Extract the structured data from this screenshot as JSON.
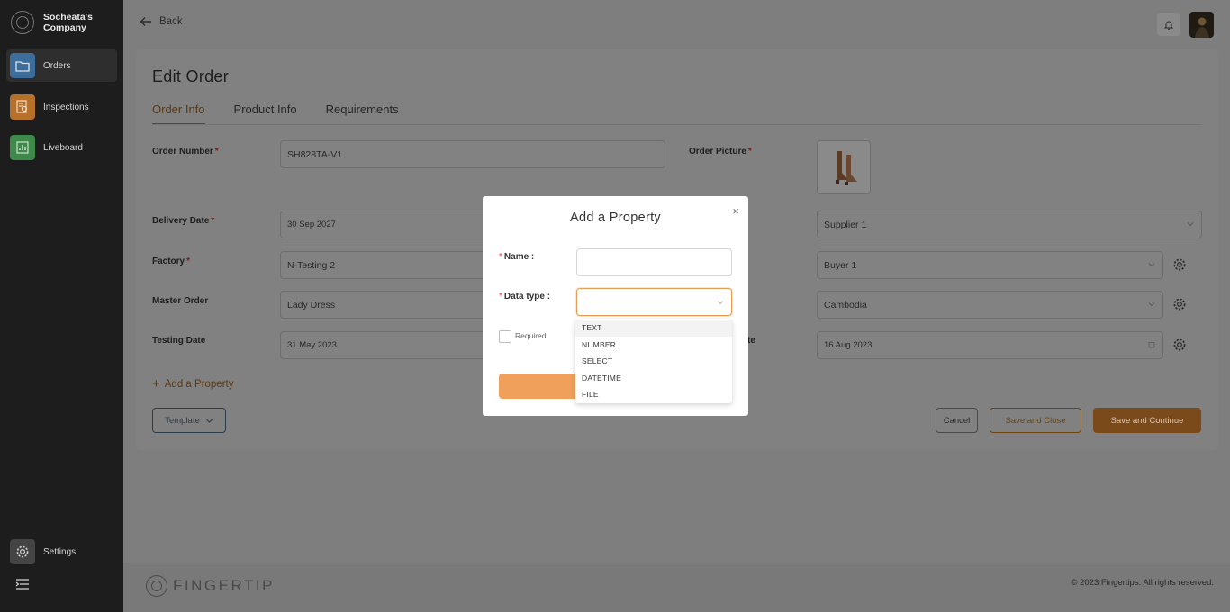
{
  "sidebar": {
    "company": "Socheata's Company",
    "items": [
      {
        "label": "Orders",
        "icon": "folder-icon",
        "color": "#3d6d9a"
      },
      {
        "label": "Inspections",
        "icon": "inspection-icon",
        "color": "#b7702a"
      },
      {
        "label": "Liveboard",
        "icon": "chart-icon",
        "color": "#3e8a4a"
      }
    ],
    "settings_label": "Settings"
  },
  "header": {
    "back_label": "Back"
  },
  "page": {
    "title": "Edit Order",
    "tabs": [
      {
        "label": "Order Info",
        "active": true
      },
      {
        "label": "Product Info",
        "active": false
      },
      {
        "label": "Requirements",
        "active": false
      }
    ]
  },
  "form": {
    "order_number_label": "Order Number",
    "order_number_value": "SH828TA-V1",
    "order_picture_label": "Order Picture",
    "delivery_date_label": "Delivery Date",
    "delivery_date_value": "30 Sep 2027",
    "factory_label": "Factory",
    "factory_value": "N-Testing 2",
    "master_order_label": "Master Order",
    "master_order_value": "Lady Dress",
    "testing_date_label": "Testing Date",
    "testing_date_value": "31 May 2023",
    "supplier_value": "Supplier 1",
    "buyer_value": "Buyer 1",
    "country_value": "Cambodia",
    "right_date_label_fragment": "te",
    "right_date_value": "16 Aug 2023",
    "required_mark": "*"
  },
  "actions": {
    "add_property": "Add a Property",
    "template": "Template",
    "cancel": "Cancel",
    "save_close": "Save and Close",
    "save_continue": "Save and Continue"
  },
  "footer": {
    "logo_word": "FINGERTIP",
    "copyright": "© 2023 Fingertips. All rights reserved."
  },
  "modal": {
    "title": "Add a Property",
    "name_label": "Name",
    "data_type_label": "Data type",
    "required_label": "Required",
    "options": [
      "TEXT",
      "NUMBER",
      "SELECT",
      "DATETIME",
      "FILE"
    ]
  },
  "colors": {
    "accent": "#f0a05a",
    "brand_brown": "#7a4a1a",
    "sidebar_bg": "#1d1d1d"
  }
}
